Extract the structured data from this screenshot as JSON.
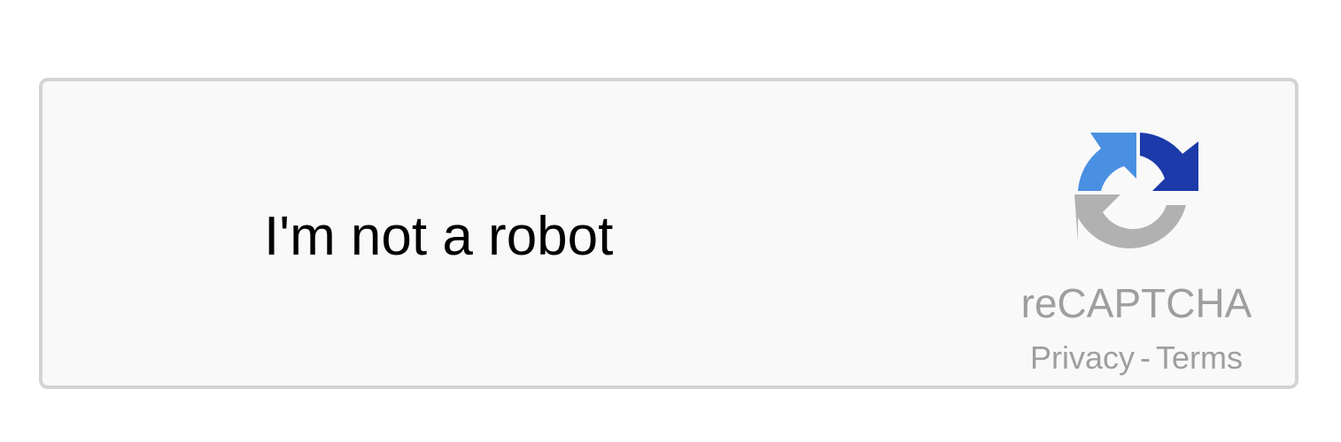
{
  "widget": {
    "checkbox_label": "I'm not a robot",
    "checked": false
  },
  "brand": {
    "name": "reCAPTCHA",
    "logo_icon": "recaptcha-logo-icon",
    "privacy_link": "Privacy",
    "separator": "-",
    "terms_link": "Terms"
  },
  "colors": {
    "widget_bg": "#f9f9f9",
    "widget_border": "#d3d3d3",
    "logo_blue_light": "#4a90e2",
    "logo_blue_dark": "#1c3aa9",
    "logo_gray": "#b1b1b1",
    "brand_text": "#9e9e9e"
  }
}
